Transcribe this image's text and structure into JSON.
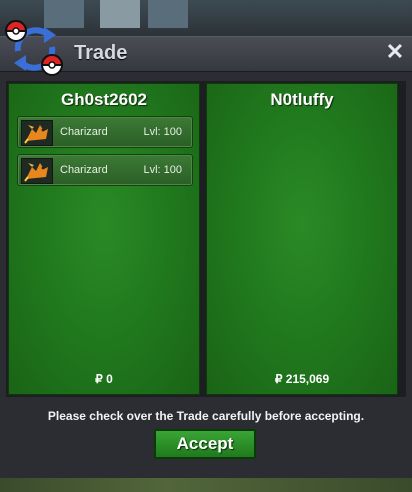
{
  "window": {
    "title": "Trade",
    "close_symbol": "✕"
  },
  "left_panel": {
    "player_name": "Gh0st2602",
    "items": [
      {
        "icon": "charizard-sprite-icon",
        "name": "Charizard",
        "level": "Lvl: 100"
      },
      {
        "icon": "charizard-sprite-icon",
        "name": "Charizard",
        "level": "Lvl: 100"
      }
    ],
    "money": "₽ 0"
  },
  "right_panel": {
    "player_name": "N0tluffy",
    "items": [],
    "money": "₽ 215,069"
  },
  "footer": {
    "message": "Please check over the Trade carefully before accepting.",
    "accept_label": "Accept"
  },
  "colors": {
    "panel_green": "#217a1e",
    "accept_green": "#2e8f2a",
    "title_bar": "#3e4148"
  }
}
